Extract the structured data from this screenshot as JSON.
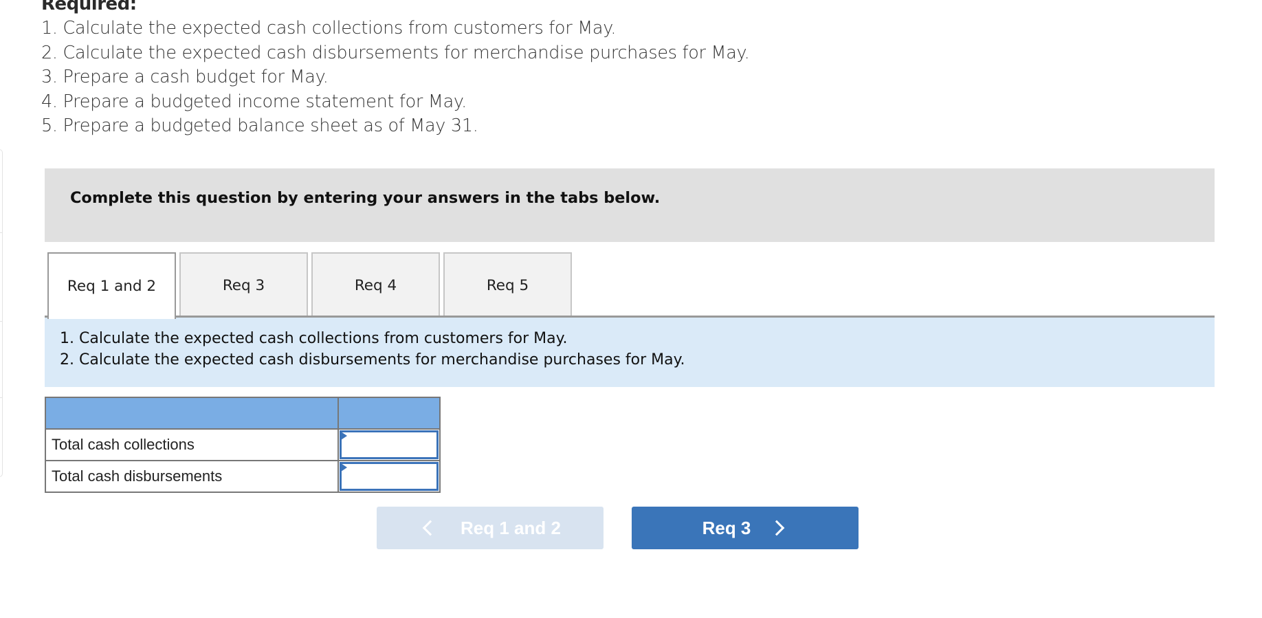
{
  "required": {
    "title": "Required:",
    "items": [
      "1. Calculate the expected cash collections from customers for May.",
      "2. Calculate the expected cash disbursements for merchandise purchases for May.",
      "3. Prepare a cash budget for May.",
      "4. Prepare a budgeted income statement for May.",
      "5. Prepare a budgeted balance sheet as of May 31."
    ]
  },
  "banner": {
    "text": "Complete this question by entering your answers in the tabs below."
  },
  "tabs": [
    {
      "label": "Req 1 and 2",
      "active": true
    },
    {
      "label": "Req 3",
      "active": false
    },
    {
      "label": "Req 4",
      "active": false
    },
    {
      "label": "Req 5",
      "active": false
    }
  ],
  "instructions": [
    "1. Calculate the expected cash collections from customers for May.",
    "2. Calculate the expected cash disbursements for merchandise purchases for May."
  ],
  "table": {
    "header": [
      "",
      ""
    ],
    "rows": [
      {
        "label": "Total cash collections",
        "value": ""
      },
      {
        "label": "Total cash disbursements",
        "value": ""
      }
    ]
  },
  "nav": {
    "prev_label": "Req 1 and 2",
    "prev_icon": "chevron-left-icon",
    "next_label": "Req 3",
    "next_icon": "chevron-right-icon"
  },
  "colors": {
    "banner_bg": "#e0e0e0",
    "instructions_bg": "#daeaf8",
    "table_header_bg": "#7aade4",
    "input_border": "#3b73b9",
    "next_button_bg": "#3a75b9",
    "prev_button_bg_disabled": "#d8e3f0"
  }
}
